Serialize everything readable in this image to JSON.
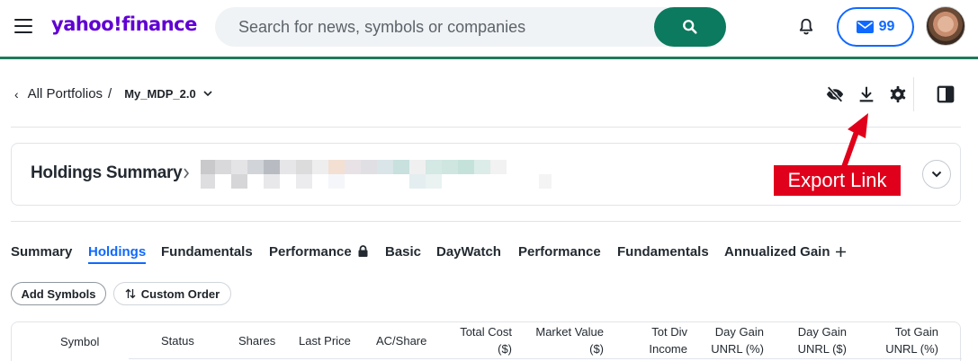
{
  "header": {
    "logo": "yahoo!finance",
    "search_placeholder": "Search for news, symbols or companies",
    "mail_count": "99"
  },
  "breadcrumb": {
    "back": "‹",
    "all_portfolios": "All Portfolios",
    "separator": "/",
    "portfolio_name": "My_MDP_2.0"
  },
  "summary": {
    "title": "Holdings Summary"
  },
  "annotation": {
    "export_label": "Export Link",
    "color": "#e0001b"
  },
  "tabs": [
    {
      "label": "Summary"
    },
    {
      "label": "Holdings"
    },
    {
      "label": "Fundamentals"
    },
    {
      "label": "Performance"
    },
    {
      "label": "Basic"
    },
    {
      "label": "DayWatch"
    },
    {
      "label": "Performance"
    },
    {
      "label": "Fundamentals"
    },
    {
      "label": "Annualized Gain"
    }
  ],
  "active_tab": "Holdings",
  "buttons": {
    "add_symbols": "Add Symbols",
    "custom_order": "Custom Order"
  },
  "table": {
    "columns": [
      {
        "line1": "Symbol",
        "line2": ""
      },
      {
        "line1": "Status",
        "line2": ""
      },
      {
        "line1": "Shares",
        "line2": ""
      },
      {
        "line1": "Last Price",
        "line2": ""
      },
      {
        "line1": "AC/Share",
        "line2": ""
      },
      {
        "line1": "Total Cost",
        "line2": "($)"
      },
      {
        "line1": "Market Value",
        "line2": "($)"
      },
      {
        "line1": "Tot Div",
        "line2": "Income"
      },
      {
        "line1": "Day Gain",
        "line2": "UNRL (%)"
      },
      {
        "line1": "Day Gain",
        "line2": "UNRL ($)"
      },
      {
        "line1": "Tot Gain",
        "line2": "UNRL (%)"
      }
    ]
  },
  "colors": {
    "brand_purple": "#6001d2",
    "search_green": "#0c7a5f",
    "accent_blue": "#0f69ff",
    "header_rule_green": "#1f7a5c"
  }
}
